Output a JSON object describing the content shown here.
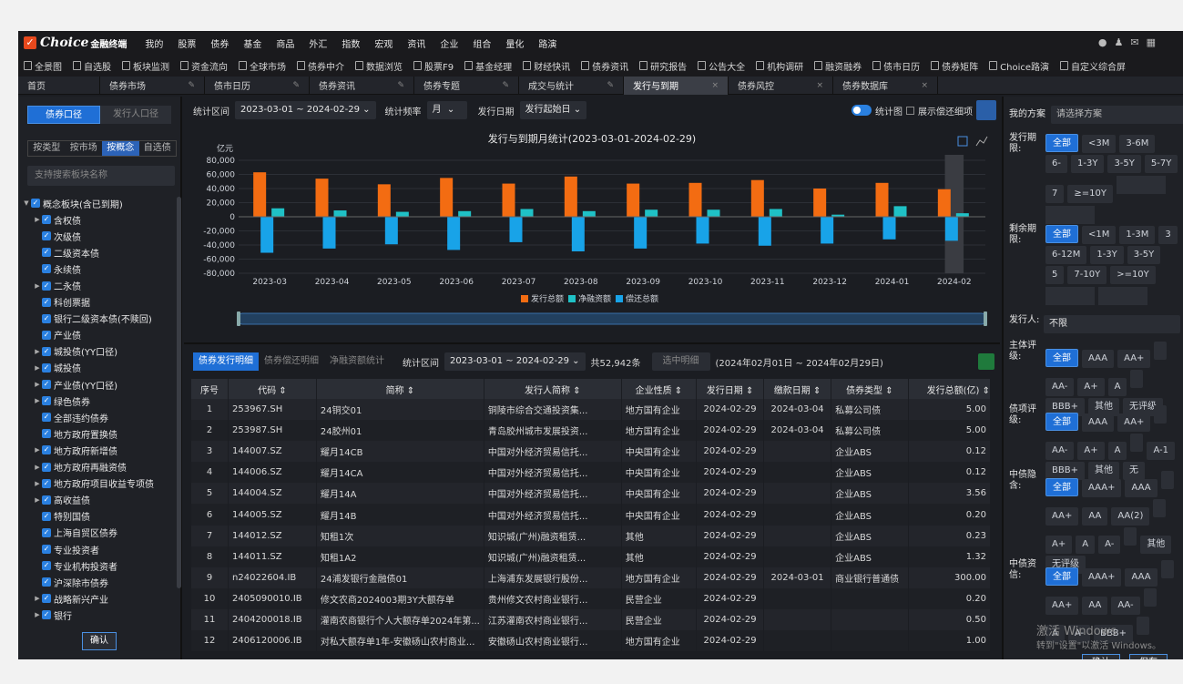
{
  "menu": {
    "logo_name": "Choice",
    "logo_sub": "金融终端",
    "items": [
      "我的",
      "股票",
      "债券",
      "基金",
      "商品",
      "外汇",
      "指数",
      "宏观",
      "资讯",
      "企业",
      "组合",
      "量化",
      "路演"
    ]
  },
  "toolbar": [
    "全景图",
    "自选股",
    "板块监测",
    "资金流向",
    "全球市场",
    "债券中介",
    "数据浏览",
    "股票F9",
    "基金经理",
    "财经快讯",
    "债券资讯",
    "研究报告",
    "公告大全",
    "机构调研",
    "融资融券",
    "债市日历",
    "债券矩阵",
    "Choice路演",
    "自定义综合屏"
  ],
  "tabs": [
    {
      "label": "首页"
    },
    {
      "label": "债券市场"
    },
    {
      "label": "债市日历"
    },
    {
      "label": "债券资讯"
    },
    {
      "label": "债券专题"
    },
    {
      "label": "成交与统计"
    },
    {
      "label": "发行与到期",
      "active": true
    },
    {
      "label": "债券风控"
    },
    {
      "label": "债券数据库"
    }
  ],
  "left": {
    "seg_on": "债券口径",
    "seg_off": "发行人口径",
    "tabs": [
      "按类型",
      "按市场",
      "按概念",
      "自选债"
    ],
    "active_tab": "按概念",
    "search_placeholder": "支持搜索板块名称",
    "confirm": "确认",
    "tree": [
      {
        "label": "概念板块(含已到期)",
        "lvl": 0,
        "arrow": "▼"
      },
      {
        "label": "含权债",
        "lvl": 1,
        "arrow": "▶"
      },
      {
        "label": "次级债",
        "lvl": 1
      },
      {
        "label": "二级资本债",
        "lvl": 1
      },
      {
        "label": "永续债",
        "lvl": 1
      },
      {
        "label": "二永债",
        "lvl": 1,
        "arrow": "▶"
      },
      {
        "label": "科创票据",
        "lvl": 1
      },
      {
        "label": "银行二级资本债(不赎回)",
        "lvl": 1
      },
      {
        "label": "产业债",
        "lvl": 1
      },
      {
        "label": "城投债(YY口径)",
        "lvl": 1,
        "arrow": "▶"
      },
      {
        "label": "城投债",
        "lvl": 1,
        "arrow": "▶"
      },
      {
        "label": "产业债(YY口径)",
        "lvl": 1,
        "arrow": "▶"
      },
      {
        "label": "绿色债券",
        "lvl": 1,
        "arrow": "▶"
      },
      {
        "label": "全部违约债券",
        "lvl": 1
      },
      {
        "label": "地方政府置换债",
        "lvl": 1
      },
      {
        "label": "地方政府新增债",
        "lvl": 1,
        "arrow": "▶"
      },
      {
        "label": "地方政府再融资债",
        "lvl": 1,
        "arrow": "▶"
      },
      {
        "label": "地方政府项目收益专项债",
        "lvl": 1,
        "arrow": "▶"
      },
      {
        "label": "高收益债",
        "lvl": 1,
        "arrow": "▶"
      },
      {
        "label": "特别国债",
        "lvl": 1
      },
      {
        "label": "上海自贸区债券",
        "lvl": 1
      },
      {
        "label": "专业投资者",
        "lvl": 1
      },
      {
        "label": "专业机构投资者",
        "lvl": 1
      },
      {
        "label": "沪深除市债券",
        "lvl": 1
      },
      {
        "label": "战略新兴产业",
        "lvl": 1,
        "arrow": "▶"
      },
      {
        "label": "银行",
        "lvl": 1,
        "arrow": "▶"
      }
    ]
  },
  "filter": {
    "range_label": "统计区间",
    "range": "2023-03-01 ~ 2024-02-29",
    "freq_label": "统计频率",
    "freq": "月",
    "date_label": "发行日期",
    "date": "发行起始日",
    "chart_label": "统计图",
    "show_label": "展示偿还细项"
  },
  "chart_data": {
    "type": "bar",
    "title": "发行与到期月统计(2023-03-01-2024-02-29)",
    "ylabel": "亿元",
    "categories": [
      "2023-03",
      "2023-04",
      "2023-05",
      "2023-06",
      "2023-07",
      "2023-08",
      "2023-09",
      "2023-10",
      "2023-11",
      "2023-12",
      "2024-01",
      "2024-02"
    ],
    "ylim": [
      -80000,
      80000
    ],
    "yticks": [
      80000,
      60000,
      40000,
      20000,
      0,
      -20000,
      -40000,
      -60000,
      -80000
    ],
    "ytick_labels": [
      "80,000",
      "60,000",
      "40,000",
      "20,000",
      "0",
      "-20,000",
      "-40,000",
      "-60,000",
      "-80,000"
    ],
    "series": [
      {
        "name": "发行总额",
        "color": "#f36c12",
        "values": [
          63000,
          54000,
          46000,
          55000,
          47000,
          57000,
          47000,
          48000,
          52000,
          40000,
          48000,
          39000
        ]
      },
      {
        "name": "净融资额",
        "color": "#1fc1c6",
        "values": [
          12000,
          9000,
          7000,
          8000,
          11000,
          8000,
          10000,
          10000,
          11000,
          3000,
          15000,
          5000
        ]
      },
      {
        "name": "偿还总额",
        "color": "#18a3e8",
        "values": [
          -51000,
          -45000,
          -39000,
          -47000,
          -36000,
          -49000,
          -45000,
          -38000,
          -41000,
          -38000,
          -32000,
          -34000
        ]
      }
    ]
  },
  "table_filter": {
    "tabs": [
      "债券发行明细",
      "债券偿还明细",
      "净融资额统计"
    ],
    "range_label": "统计区间",
    "range": "2023-03-01 ~ 2024-02-29",
    "total": "共52,942条",
    "detail_btn": "选中明细",
    "period": "(2024年02月01日 ~ 2024年02月29日)"
  },
  "table": {
    "headers": [
      "序号",
      "代码 ⇕",
      "简称 ⇕",
      "发行人简称 ⇕",
      "企业性质 ⇕",
      "发行日期 ⇕",
      "缴款日期 ⇕",
      "债券类型 ⇕",
      "发行总额(亿) ⇕"
    ],
    "rows": [
      [
        "1",
        "253967.SH",
        "24铜交01",
        "铜陵市综合交通投资集...",
        "地方国有企业",
        "2024-02-29",
        "2024-03-04",
        "私募公司债",
        "5.00"
      ],
      [
        "2",
        "253987.SH",
        "24胶州01",
        "青岛胶州城市发展投资...",
        "地方国有企业",
        "2024-02-29",
        "2024-03-04",
        "私募公司债",
        "5.00"
      ],
      [
        "3",
        "144007.SZ",
        "耀月14CB",
        "中国对外经济贸易信托...",
        "中央国有企业",
        "2024-02-29",
        "",
        "企业ABS",
        "0.12"
      ],
      [
        "4",
        "144006.SZ",
        "耀月14CA",
        "中国对外经济贸易信托...",
        "中央国有企业",
        "2024-02-29",
        "",
        "企业ABS",
        "0.12"
      ],
      [
        "5",
        "144004.SZ",
        "耀月14A",
        "中国对外经济贸易信托...",
        "中央国有企业",
        "2024-02-29",
        "",
        "企业ABS",
        "3.56"
      ],
      [
        "6",
        "144005.SZ",
        "耀月14B",
        "中国对外经济贸易信托...",
        "中央国有企业",
        "2024-02-29",
        "",
        "企业ABS",
        "0.20"
      ],
      [
        "7",
        "144012.SZ",
        "知租1次",
        "知识城(广州)融资租赁...",
        "其他",
        "2024-02-29",
        "",
        "企业ABS",
        "0.23"
      ],
      [
        "8",
        "144011.SZ",
        "知租1A2",
        "知识城(广州)融资租赁...",
        "其他",
        "2024-02-29",
        "",
        "企业ABS",
        "1.32"
      ],
      [
        "9",
        "n24022604.IB",
        "24浦发银行金融债01",
        "上海浦东发展银行股份...",
        "地方国有企业",
        "2024-02-29",
        "2024-03-01",
        "商业银行普通债",
        "300.00"
      ],
      [
        "10",
        "2405090010.IB",
        "修文农商2024003期3Y大额存单",
        "贵州修文农村商业银行...",
        "民营企业",
        "2024-02-29",
        "",
        "",
        "0.20"
      ],
      [
        "11",
        "2404200018.IB",
        "灌南农商银行个人大额存单2024年第...",
        "江苏灌南农村商业银行...",
        "民营企业",
        "2024-02-29",
        "",
        "",
        "0.50"
      ],
      [
        "12",
        "2406120006.IB",
        "对私大额存单1年-安徽砀山农村商业...",
        "安徽砀山农村商业银行...",
        "地方国有企业",
        "2024-02-29",
        "",
        "",
        "1.00"
      ]
    ]
  },
  "right": {
    "plan_label": "我的方案",
    "plan_placeholder": "请选择方案",
    "groups": [
      {
        "label": "发行期限:",
        "top": 40,
        "chips": [
          "全部",
          "<3M",
          "3-6M",
          "6-",
          "1-3Y",
          "3-5Y",
          "5-7Y",
          "7",
          "≥=10Y"
        ],
        "inputs": true
      },
      {
        "label": "剩余期限:",
        "top": 140,
        "chips": [
          "全部",
          "<1M",
          "1-3M",
          "3",
          "6-12M",
          "1-3Y",
          "3-5Y",
          "5",
          "7-10Y",
          ">=10Y"
        ],
        "inputs": true
      },
      {
        "label": "发行人:",
        "top": 240,
        "chips": [],
        "select": "不限"
      },
      {
        "label": "主体评级:",
        "top": 268,
        "chips": [
          "全部",
          "AAA",
          "AA+",
          "",
          "AA-",
          "A+",
          "A",
          "",
          "BBB+",
          "其他",
          "无评级"
        ]
      },
      {
        "label": "债项评级:",
        "top": 338,
        "chips": [
          "全部",
          "AAA",
          "AA+",
          "",
          "AA-",
          "A+",
          "A",
          "",
          "A-1",
          "BBB+",
          "其他",
          "无"
        ]
      },
      {
        "label": "中债隐含:",
        "top": 410,
        "chips": [
          "全部",
          "AAA+",
          "AAA",
          "",
          "AA+",
          "AA",
          "AA(2)",
          "",
          "A+",
          "A",
          "A-",
          "",
          "其他",
          "无评级"
        ]
      },
      {
        "label": "中债资信:",
        "top": 508,
        "chips": [
          "全部",
          "AAA+",
          "AAA",
          "",
          "AA+",
          "AA",
          "AA-",
          "",
          "A",
          "A-",
          "BBB+",
          ""
        ]
      }
    ],
    "confirm": "确认",
    "save": "保存"
  },
  "watermark": {
    "line1": "激活 Windows",
    "line2": "转到\"设置\"以激活 Windows。"
  }
}
